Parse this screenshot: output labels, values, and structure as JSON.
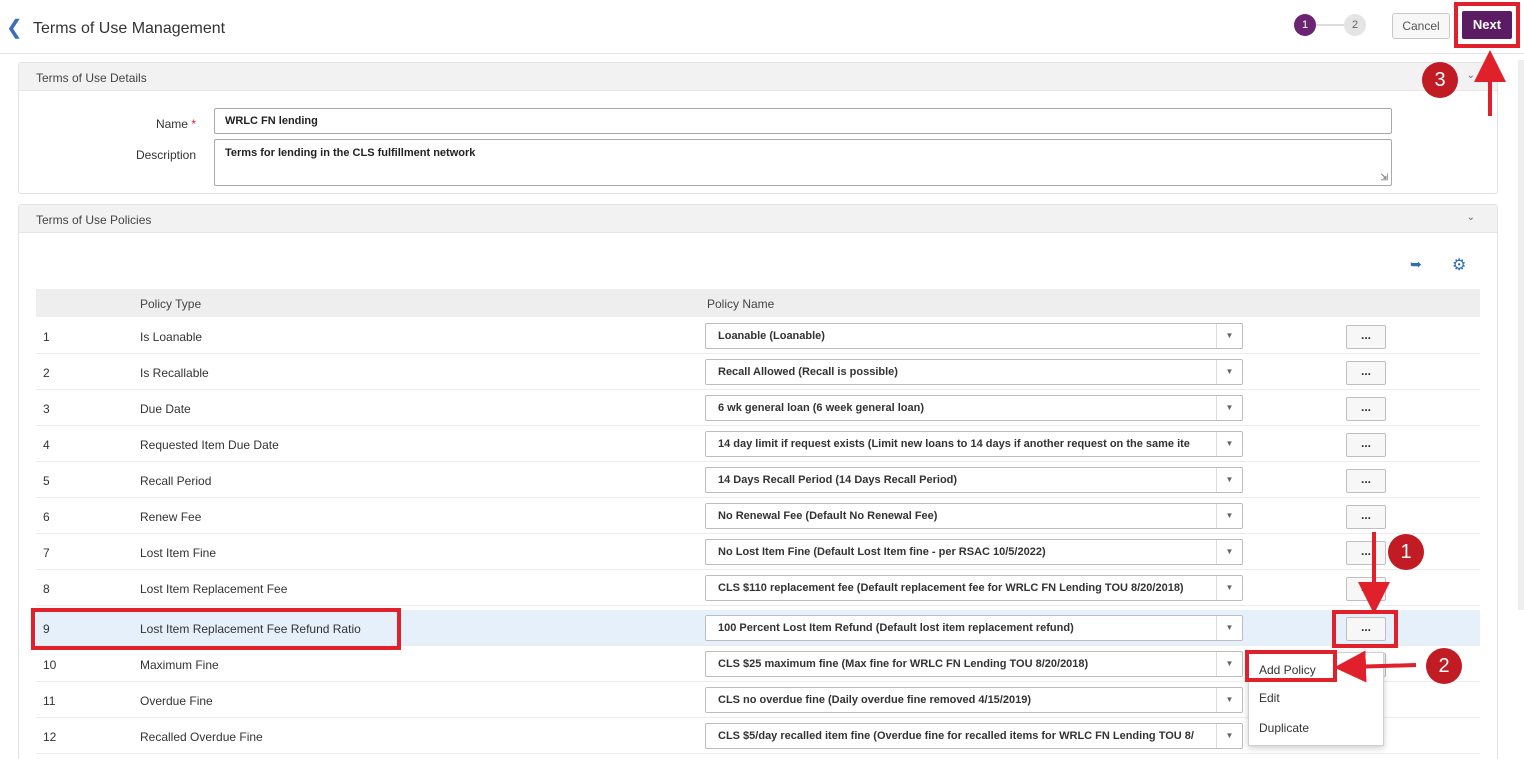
{
  "header": {
    "title": "Terms of Use Management",
    "steps": [
      "1",
      "2"
    ],
    "cancel_label": "Cancel",
    "next_label": "Next"
  },
  "details": {
    "title": "Terms of Use Details",
    "name_label": "Name",
    "name_required": "*",
    "name_value": "WRLC FN lending",
    "description_label": "Description",
    "description_value": "Terms for lending in the CLS fulfillment network"
  },
  "policies": {
    "title": "Terms of Use Policies",
    "columns": [
      "Policy Type",
      "Policy Name"
    ],
    "rows": [
      {
        "num": "1",
        "type": "Is Loanable",
        "name": "Loanable (Loanable)"
      },
      {
        "num": "2",
        "type": "Is Recallable",
        "name": "Recall Allowed (Recall is possible)"
      },
      {
        "num": "3",
        "type": "Due Date",
        "name": "6 wk general loan (6 week general loan)"
      },
      {
        "num": "4",
        "type": "Requested Item Due Date",
        "name": "14 day limit if request exists (Limit new loans to 14 days if another request on the same ite"
      },
      {
        "num": "5",
        "type": "Recall Period",
        "name": "14 Days Recall Period (14 Days Recall Period)"
      },
      {
        "num": "6",
        "type": "Renew Fee",
        "name": "No Renewal Fee (Default No Renewal Fee)"
      },
      {
        "num": "7",
        "type": "Lost Item Fine",
        "name": "No Lost Item Fine (Default Lost Item fine - per RSAC 10/5/2022)"
      },
      {
        "num": "8",
        "type": "Lost Item Replacement Fee",
        "name": "CLS $110 replacement fee (Default replacement fee for WRLC FN Lending TOU 8/20/2018)"
      },
      {
        "num": "9",
        "type": "Lost Item Replacement Fee Refund Ratio",
        "name": "100 Percent Lost Item Refund (Default lost item replacement refund)"
      },
      {
        "num": "10",
        "type": "Maximum Fine",
        "name": "CLS $25 maximum fine (Max fine for WRLC FN Lending TOU 8/20/2018)"
      },
      {
        "num": "11",
        "type": "Overdue Fine",
        "name": "CLS no overdue fine (Daily overdue fine removed 4/15/2019)"
      },
      {
        "num": "12",
        "type": "Recalled Overdue Fine",
        "name": "CLS $5/day recalled item fine (Overdue fine for recalled items for WRLC FN Lending TOU 8/"
      }
    ],
    "actions_label": "...",
    "menu": [
      "Add Policy",
      "Edit",
      "Duplicate"
    ]
  },
  "annotations": [
    "1",
    "2",
    "3"
  ],
  "colors": {
    "accent": "#5c1c63",
    "highlight": "#e0202a",
    "link": "#2f6db5"
  }
}
